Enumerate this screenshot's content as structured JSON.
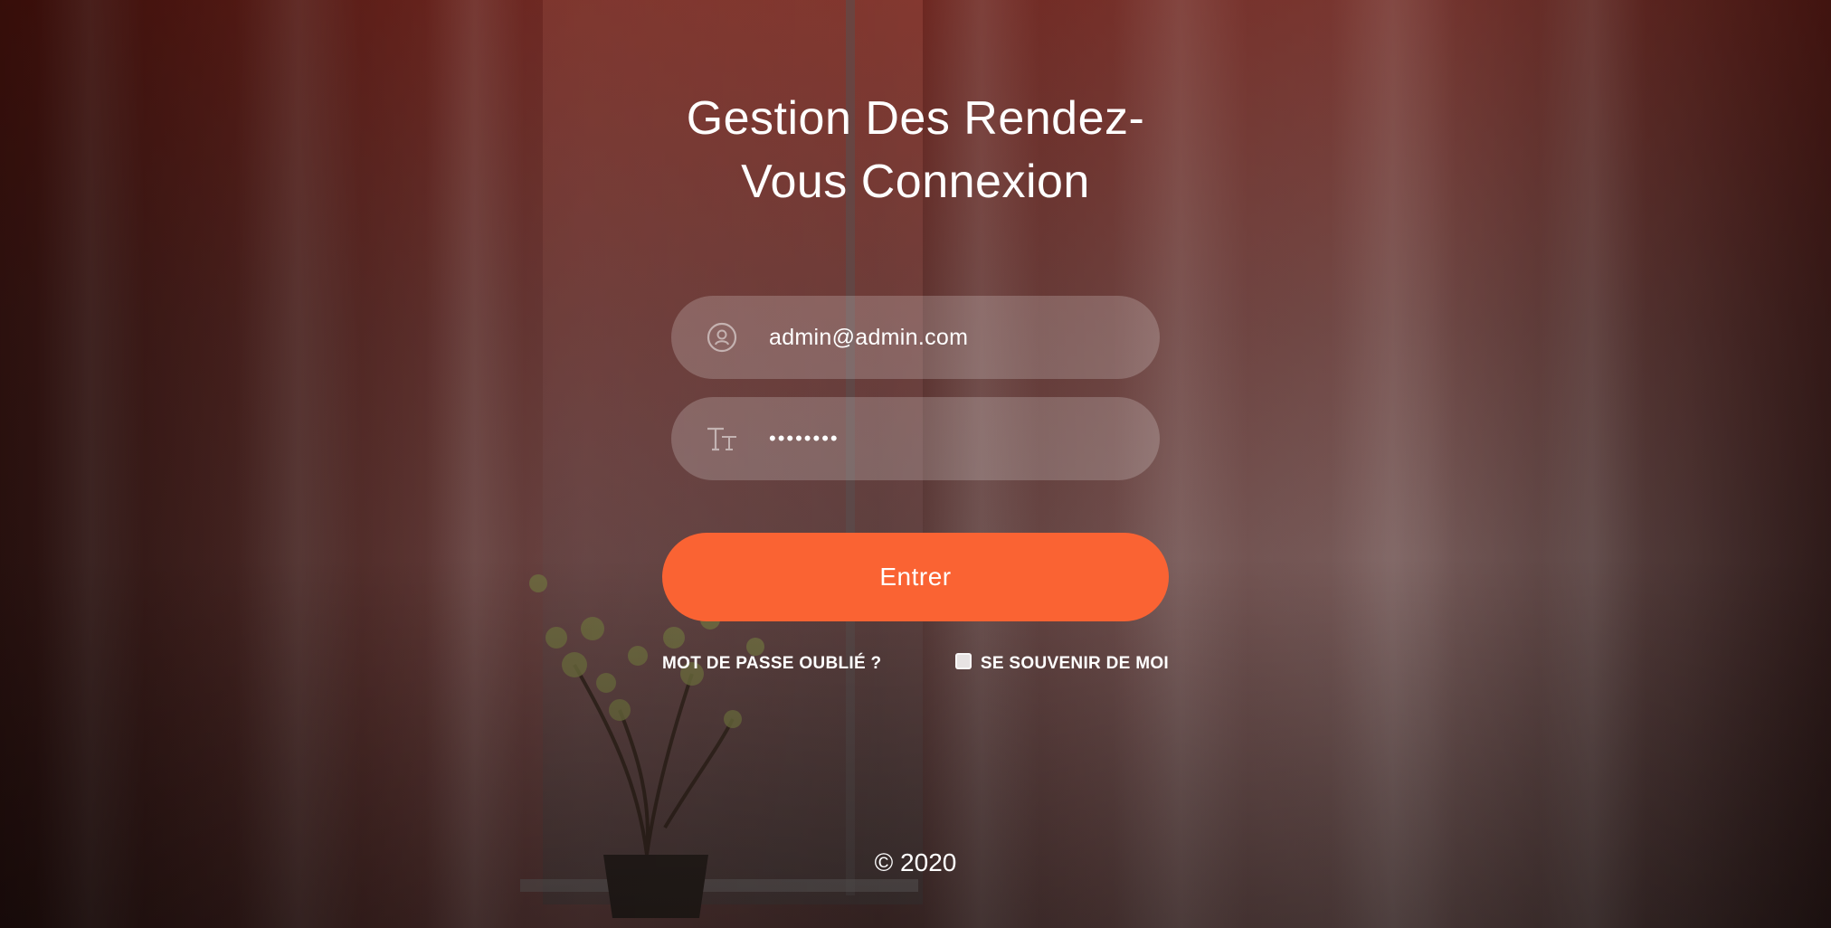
{
  "page": {
    "title": "Gestion Des Rendez-Vous Connexion",
    "footer": "© 2020"
  },
  "login_form": {
    "email": {
      "value": "admin@admin.com",
      "icon": "user-circle-icon"
    },
    "password": {
      "value": "password",
      "icon": "text-format-icon"
    },
    "submit_label": "Entrer",
    "forgot_password_label": "MOT DE PASSE OUBLIÉ ?",
    "remember_me_label": "SE SOUVENIR DE MOI",
    "remember_me_checked": false
  },
  "colors": {
    "accent": "#fa6333",
    "field_bg": "rgba(255,255,255,0.20)",
    "text": "#ffffff"
  }
}
